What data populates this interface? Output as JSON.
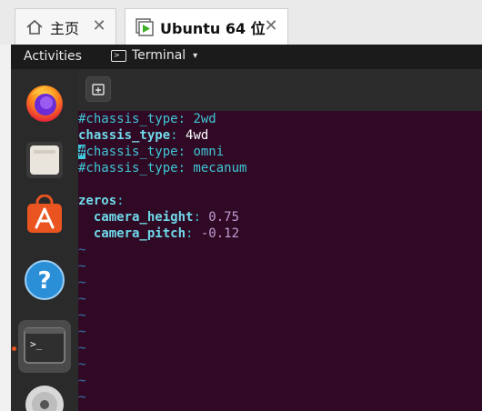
{
  "host": {
    "tabs": [
      {
        "label": "主页",
        "close": "✕"
      },
      {
        "label": "Ubuntu 64 位",
        "close": "✕"
      }
    ]
  },
  "topbar": {
    "activities": "Activities",
    "app_menu": "Terminal",
    "app_menu_caret": "▾"
  },
  "dock": {
    "items": [
      "firefox",
      "files",
      "ubuntu-software",
      "help",
      "terminal",
      "dvd"
    ],
    "terminal_glyph": ">_"
  },
  "terminal": {
    "lines": [
      {
        "comment": "#chassis_type:",
        "value": " 2wd"
      },
      {
        "key": "chassis_type",
        "sep": ":",
        "value": " 4wd"
      },
      {
        "cursor": "#",
        "comment": "chassis_type: omni"
      },
      {
        "comment": "#chassis_type: mecanum"
      },
      {
        "blank": ""
      },
      {
        "key": "zeros",
        "sep": ":"
      },
      {
        "indent": "  ",
        "key": "camera_height",
        "sep": ":",
        "num": " 0.75"
      },
      {
        "indent": "  ",
        "key": "camera_pitch",
        "sep": ":",
        "num": " -0.12"
      }
    ],
    "tilde": "~",
    "tilde_count": 10
  },
  "colors": {
    "terminal_bg": "#300a24",
    "comment": "#3fc6d6",
    "key": "#6fd9ea",
    "number": "#c39bd3",
    "accent": "#e95420"
  }
}
